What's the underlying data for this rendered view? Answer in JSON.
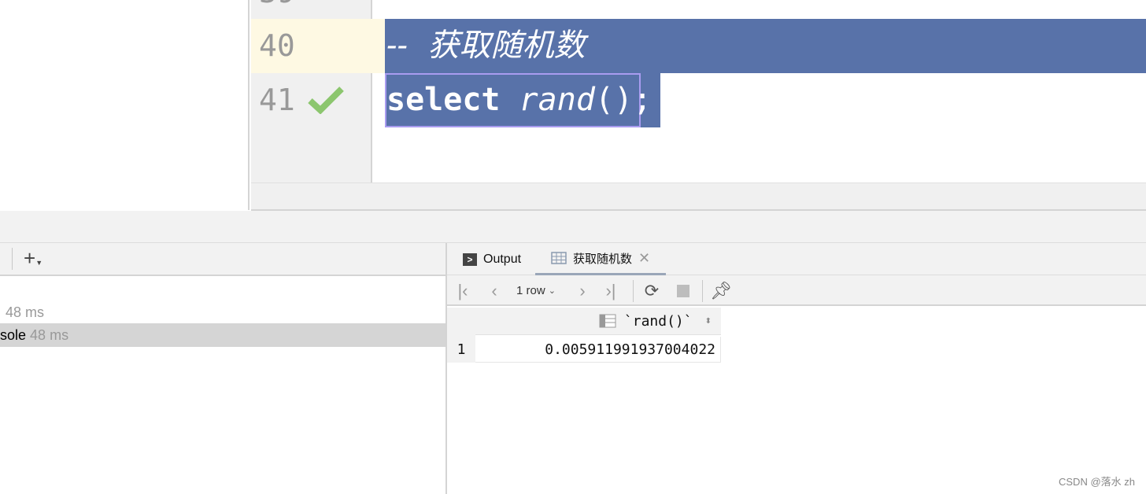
{
  "editor": {
    "lines": [
      {
        "number": "39"
      },
      {
        "number": "40",
        "text": "--  获取随机数"
      },
      {
        "number": "41",
        "keyword": "select",
        "func": "rand",
        "rest": "();",
        "status": "check-icon"
      }
    ],
    "selection_color": "#5872a9",
    "current_line_color": "#fef9e3"
  },
  "services": {
    "items": [
      {
        "label": "",
        "time": "48 ms"
      },
      {
        "label": "sole",
        "time": "48 ms",
        "selected": true
      }
    ]
  },
  "results": {
    "tabs": [
      {
        "label": "Output",
        "icon": "console-icon"
      },
      {
        "label": "获取随机数",
        "icon": "table-icon",
        "active": true
      }
    ],
    "toolbar": {
      "rows_label": "1 row"
    },
    "columns": [
      "`rand()`"
    ],
    "rows": [
      {
        "index": "1",
        "values": [
          "0.005911991937004022"
        ]
      }
    ]
  },
  "watermark": "CSDN @落水 zh"
}
